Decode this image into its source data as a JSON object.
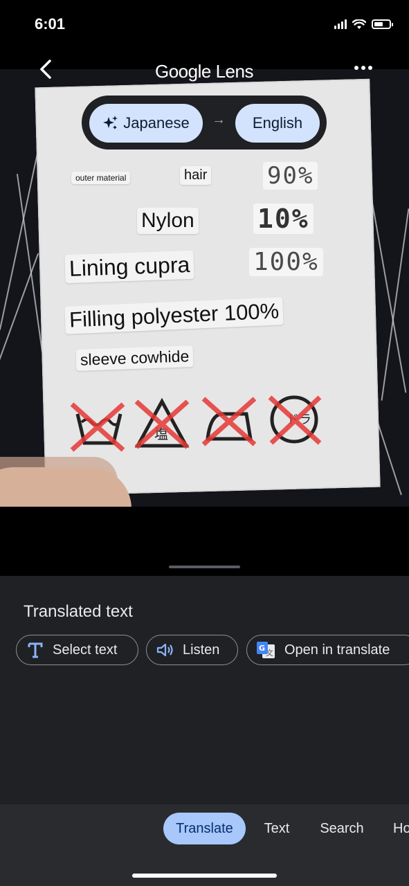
{
  "status_bar": {
    "time": "6:01"
  },
  "header": {
    "title_brand": "Google",
    "title_product": "Lens"
  },
  "language": {
    "source": "Japanese",
    "target": "English",
    "arrow": "→"
  },
  "overlays": {
    "outer_material": "outer material",
    "hair": "hair",
    "hair_pct": "90%",
    "nylon": "Nylon",
    "nylon_pct": "10%",
    "lining": "Lining cupra",
    "lining_pct": "100%",
    "filling": "Filling polyester 100%",
    "sleeve": "sleeve cowhide"
  },
  "sheet": {
    "title": "Translated text",
    "actions": {
      "select_text": "Select text",
      "listen": "Listen",
      "open_translate": "Open in translate"
    }
  },
  "tabs": {
    "translate": "Translate",
    "text": "Text",
    "search": "Search",
    "homework": "Ho"
  },
  "colors": {
    "accent_pill": "#d3e3fd",
    "active_tab": "#a8c7fa",
    "sheet_bg": "#1f2124"
  }
}
